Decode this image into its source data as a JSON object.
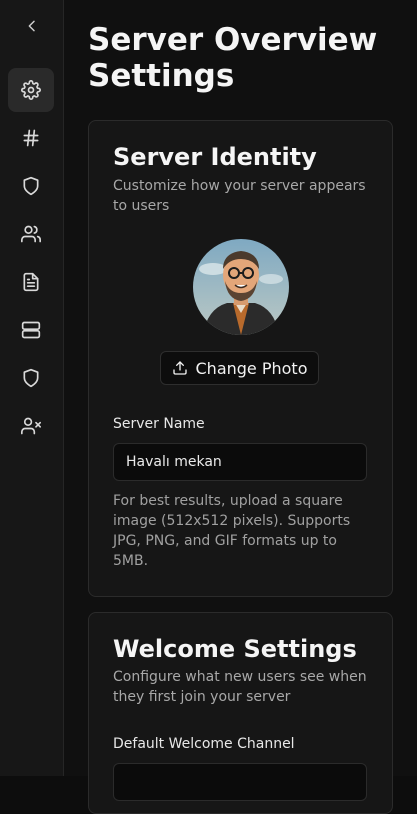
{
  "page": {
    "title": "Server Overview Settings"
  },
  "sidebar": {
    "items": [
      {
        "icon": "gear-icon",
        "active": true
      },
      {
        "icon": "hash-icon"
      },
      {
        "icon": "shield-icon"
      },
      {
        "icon": "users-icon"
      },
      {
        "icon": "document-icon"
      },
      {
        "icon": "server-icon"
      },
      {
        "icon": "shield-icon"
      },
      {
        "icon": "user-x-icon"
      }
    ]
  },
  "identity": {
    "title": "Server Identity",
    "description": "Customize how your server appears to users",
    "change_photo_label": "Change Photo",
    "server_name_label": "Server Name",
    "server_name_value": "Havalı mekan",
    "help": "For best results, upload a square image (512x512 pixels). Supports JPG, PNG, and GIF formats up to 5MB."
  },
  "welcome": {
    "title": "Welcome Settings",
    "description": "Configure what new users see when they first join your server",
    "default_channel_label": "Default Welcome Channel"
  },
  "colors": {
    "background": "#101010",
    "card": "#161616",
    "border": "#2b2b2b",
    "text": "#f5f5f5",
    "muted": "#a8a8a8"
  }
}
